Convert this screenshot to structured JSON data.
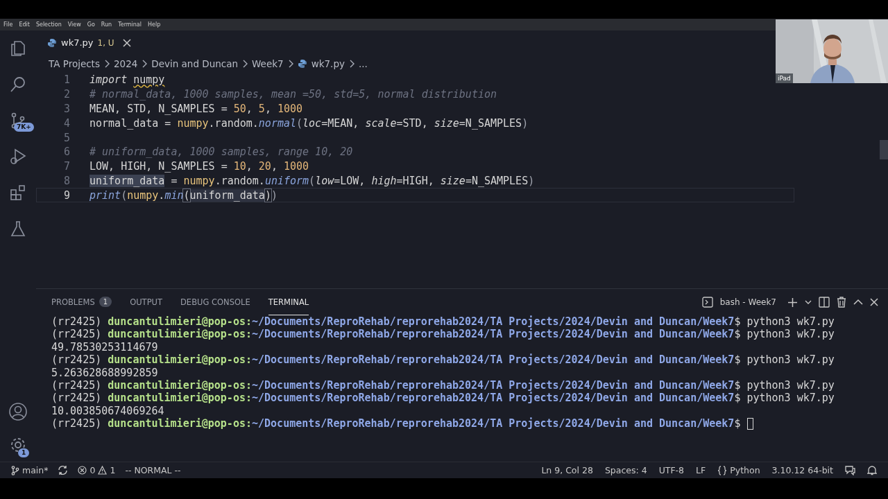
{
  "menu": [
    "File",
    "Edit",
    "Selection",
    "View",
    "Go",
    "Run",
    "Terminal",
    "Help"
  ],
  "activity_bar": {
    "top": [
      {
        "kind": "files",
        "selected": false
      },
      {
        "kind": "search",
        "selected": false
      },
      {
        "kind": "source-control",
        "selected": false,
        "badge": "7K+"
      },
      {
        "kind": "debug",
        "selected": false
      },
      {
        "kind": "extensions",
        "selected": false
      },
      {
        "kind": "testing",
        "selected": false
      }
    ],
    "bottom": [
      {
        "kind": "account"
      },
      {
        "kind": "settings",
        "badge": "1"
      }
    ]
  },
  "tabs": [
    {
      "label": "wk7.py",
      "status": "1, U",
      "selected": true
    }
  ],
  "breadcrumb": [
    {
      "label": "TA Projects",
      "kind": "folder"
    },
    {
      "label": "2024",
      "kind": "folder"
    },
    {
      "label": "Devin and Duncan",
      "kind": "folder"
    },
    {
      "label": "Week7",
      "kind": "folder"
    },
    {
      "label": "wk7.py",
      "kind": "file"
    },
    {
      "label": "...",
      "kind": "more"
    }
  ],
  "editor": {
    "lines": [
      {
        "number": "1",
        "current": false,
        "tokens": [
          {
            "text": "import ",
            "kind": "keyword"
          },
          {
            "text": "numpy",
            "kind": "warn"
          }
        ]
      },
      {
        "number": "2",
        "current": false,
        "tokens": [
          {
            "text": "# normal_data, 1000 samples, mean =50, std=5, normal distribution",
            "kind": "comment"
          }
        ]
      },
      {
        "number": "3",
        "current": false,
        "tokens": [
          {
            "text": "MEAN, STD, N_SAMPLES = ",
            "kind": "plain"
          },
          {
            "text": "50",
            "kind": "number"
          },
          {
            "text": ", ",
            "kind": "plain"
          },
          {
            "text": "5",
            "kind": "number"
          },
          {
            "text": ", ",
            "kind": "plain"
          },
          {
            "text": "1000",
            "kind": "number"
          }
        ]
      },
      {
        "number": "4",
        "current": false,
        "tokens": [
          {
            "text": "normal_data = ",
            "kind": "plain"
          },
          {
            "text": "numpy",
            "kind": "module"
          },
          {
            "text": ".random.",
            "kind": "plain"
          },
          {
            "text": "normal",
            "kind": "func"
          },
          {
            "text": "(",
            "kind": "paren"
          },
          {
            "text": "loc",
            "kind": "param"
          },
          {
            "text": "=MEAN, ",
            "kind": "plain"
          },
          {
            "text": "scale",
            "kind": "param"
          },
          {
            "text": "=STD, ",
            "kind": "plain"
          },
          {
            "text": "size",
            "kind": "param"
          },
          {
            "text": "=N_SAMPLES",
            "kind": "plain"
          },
          {
            "text": ")",
            "kind": "paren"
          }
        ]
      },
      {
        "number": "5",
        "current": false
      },
      {
        "number": "6",
        "current": false,
        "tokens": [
          {
            "text": "# uniform_data, 1000 samples, range 10, 20",
            "kind": "comment"
          }
        ]
      },
      {
        "number": "7",
        "current": false,
        "tokens": [
          {
            "text": "LOW, HIGH, N_SAMPLES = ",
            "kind": "plain"
          },
          {
            "text": "10",
            "kind": "number"
          },
          {
            "text": ", ",
            "kind": "plain"
          },
          {
            "text": "20",
            "kind": "number"
          },
          {
            "text": ", ",
            "kind": "plain"
          },
          {
            "text": "1000",
            "kind": "number"
          }
        ]
      },
      {
        "number": "8",
        "current": false,
        "tokens": [
          {
            "text": "uniform_data",
            "kind": "selected"
          },
          {
            "text": " = ",
            "kind": "plain"
          },
          {
            "text": "numpy",
            "kind": "module"
          },
          {
            "text": ".random.",
            "kind": "plain"
          },
          {
            "text": "uniform",
            "kind": "func"
          },
          {
            "text": "(",
            "kind": "paren"
          },
          {
            "text": "low",
            "kind": "param"
          },
          {
            "text": "=LOW, ",
            "kind": "plain"
          },
          {
            "text": "high",
            "kind": "param"
          },
          {
            "text": "=HIGH, ",
            "kind": "plain"
          },
          {
            "text": "size",
            "kind": "param"
          },
          {
            "text": "=N_SAMPLES",
            "kind": "plain"
          },
          {
            "text": ")",
            "kind": "paren"
          }
        ]
      },
      {
        "number": "9",
        "current": true,
        "tokens": [
          {
            "text": "print",
            "kind": "func"
          },
          {
            "text": "(",
            "kind": "paren"
          },
          {
            "text": "numpy",
            "kind": "module"
          },
          {
            "text": ".",
            "kind": "plain"
          },
          {
            "text": "min",
            "kind": "func"
          },
          {
            "text": "(",
            "kind": "match"
          },
          {
            "text": "uniform_data",
            "kind": "highlight"
          },
          {
            "text": ")",
            "kind": "match"
          },
          {
            "text": ")",
            "kind": "paren"
          }
        ]
      }
    ]
  },
  "panel": {
    "tabs": [
      {
        "label": "PROBLEMS",
        "badge": "1",
        "selected": false
      },
      {
        "label": "OUTPUT",
        "selected": false
      },
      {
        "label": "DEBUG CONSOLE",
        "selected": false
      },
      {
        "label": "TERMINAL",
        "selected": true
      }
    ],
    "terminal_name": "bash - Week7",
    "terminal": [
      {
        "kind": "prompt",
        "env": "(rr2425) ",
        "user": "duncantulimieri@pop-os:",
        "path": "~/Documents/ReproRehab/reprorehab2024/TA Projects/2024/Devin and Duncan/Week7",
        "command": "$ python3 wk7.py",
        "cursor": false
      },
      {
        "kind": "prompt",
        "env": "(rr2425) ",
        "user": "duncantulimieri@pop-os:",
        "path": "~/Documents/ReproRehab/reprorehab2024/TA Projects/2024/Devin and Duncan/Week7",
        "command": "$ python3 wk7.py",
        "cursor": false
      },
      {
        "kind": "output",
        "text": "49.78530253114679"
      },
      {
        "kind": "prompt",
        "env": "(rr2425) ",
        "user": "duncantulimieri@pop-os:",
        "path": "~/Documents/ReproRehab/reprorehab2024/TA Projects/2024/Devin and Duncan/Week7",
        "command": "$ python3 wk7.py",
        "cursor": false
      },
      {
        "kind": "output",
        "text": "5.263628688992859"
      },
      {
        "kind": "prompt",
        "env": "(rr2425) ",
        "user": "duncantulimieri@pop-os:",
        "path": "~/Documents/ReproRehab/reprorehab2024/TA Projects/2024/Devin and Duncan/Week7",
        "command": "$ python3 wk7.py",
        "cursor": false
      },
      {
        "kind": "prompt",
        "env": "(rr2425) ",
        "user": "duncantulimieri@pop-os:",
        "path": "~/Documents/ReproRehab/reprorehab2024/TA Projects/2024/Devin and Duncan/Week7",
        "command": "$ python3 wk7.py",
        "cursor": false
      },
      {
        "kind": "output",
        "text": "10.003850674069264"
      },
      {
        "kind": "prompt",
        "env": "(rr2425) ",
        "user": "duncantulimieri@pop-os:",
        "path": "~/Documents/ReproRehab/reprorehab2024/TA Projects/2024/Devin and Duncan/Week7",
        "command": "$",
        "cursor": true
      }
    ]
  },
  "status_bar": {
    "branch": "main*",
    "errors": "0",
    "warnings": "1",
    "mode": "-- NORMAL --",
    "right": [
      {
        "text": "Ln 9, Col 28",
        "kind": "text"
      },
      {
        "text": "Spaces: 4",
        "kind": "text"
      },
      {
        "text": "UTF-8",
        "kind": "text"
      },
      {
        "text": "LF",
        "kind": "text"
      },
      {
        "text": "Python",
        "kind": "language"
      },
      {
        "text": "3.10.12 64-bit",
        "kind": "text"
      }
    ]
  },
  "webcam": {
    "label": "iPad"
  }
}
